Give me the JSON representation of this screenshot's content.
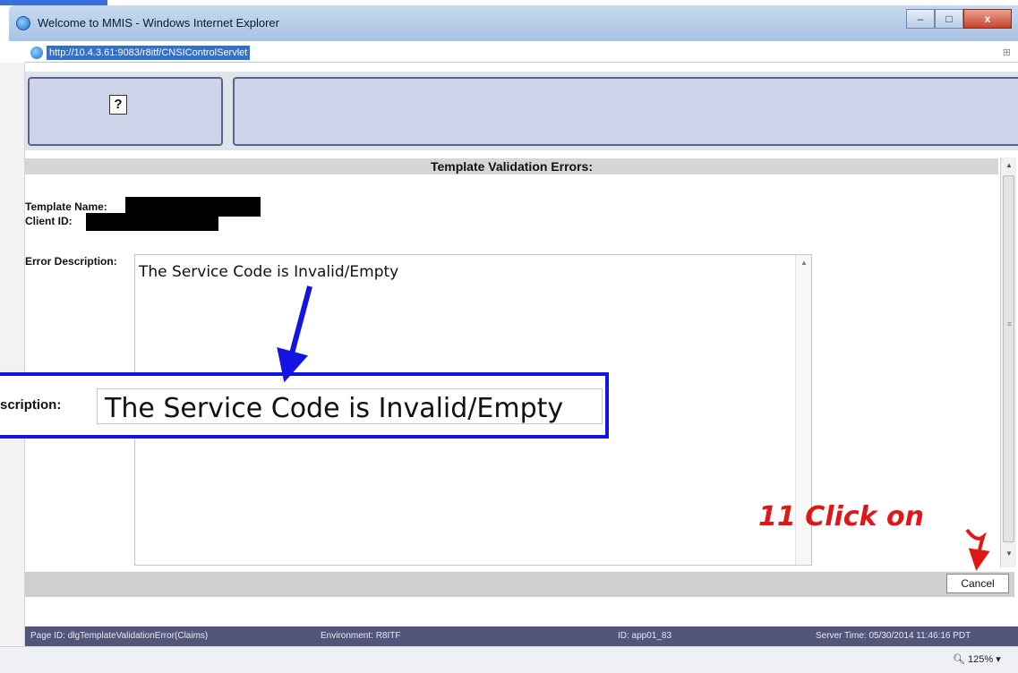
{
  "window": {
    "title": "Welcome to MMIS - Windows Internet Explorer",
    "minimize_glyph": "–",
    "maximize_glyph": "□",
    "close_glyph": "x"
  },
  "address_bar": {
    "url": "http://10.4.3.61:9083/r8itf/CNSIControlServlet"
  },
  "toolbar": {
    "help_label": "?"
  },
  "dialog": {
    "title": "Template Validation Errors:",
    "template_name_label": "Template Name:",
    "client_id_label": "Client ID:",
    "error_description_label": "Error Description:",
    "error_description_value": "The Service Code is Invalid/Empty",
    "cancel_label": "Cancel"
  },
  "callout": {
    "label": "scription:",
    "value": "The Service Code is Invalid/Empty"
  },
  "annotation": {
    "step_text": "11 Click on",
    "color": "#e01717",
    "callout_color": "#1414e0"
  },
  "status_bar": {
    "page_id": "Page ID: dlgTemplateValidationError(Claims)",
    "environment": "Environment: R8ITF",
    "id": "ID: app01_83",
    "server_time": "Server Time: 05/30/2014 11:46:16 PDT"
  },
  "ie_status": {
    "zoom": "125%"
  }
}
